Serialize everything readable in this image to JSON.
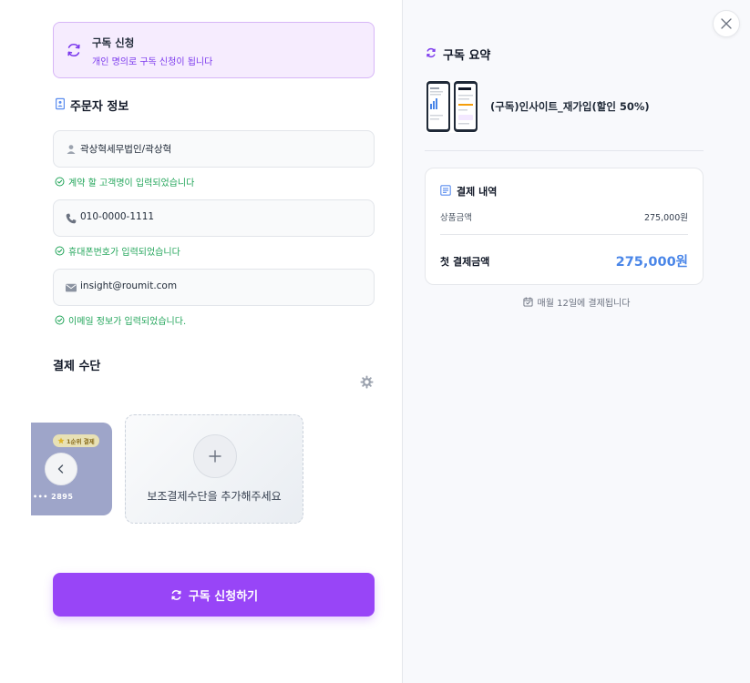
{
  "subscription_box": {
    "title": "구독 신청",
    "subtitle": "개인 명의로 구독 신청이 됩니다",
    "icon": "refresh-icon"
  },
  "orderer": {
    "title": "주문자 정보",
    "icon": "contact-card-icon",
    "fields": [
      {
        "icon": "person-icon",
        "value": "곽상혁세무법인/곽상혁",
        "validation": "계약 할 고객명이 입력되었습니다"
      },
      {
        "icon": "phone-icon",
        "value": "010-0000-1111",
        "validation": "휴대폰번호가 입력되었습니다"
      },
      {
        "icon": "mail-icon",
        "value": "insight@roumit.com",
        "validation": "이메일 정보가 입력되었습니다."
      }
    ]
  },
  "payment_method": {
    "title": "결제 수단",
    "main_card": {
      "badge": "1순위 결제",
      "masked_number": "••• 2895"
    },
    "add_card_label": "보조결제수단을 추가해주세요"
  },
  "submit": {
    "label": "구독 신청하기"
  },
  "summary": {
    "title": "구독 요약",
    "product_name": "(구독)인사이트_재가입(할인 50%)"
  },
  "payment_details": {
    "title": "결제 내역",
    "product_amount_label": "상품금액",
    "product_amount_value": "275,000원",
    "first_payment_label": "첫 결제금액",
    "first_payment_value": "275,000원"
  },
  "billing_note": "매월 12일에 결제됩니다",
  "colors": {
    "accent": "#9845f7",
    "valid": "#22a55a",
    "price": "#4a86e8",
    "subscription_box_bg": "#f6ecfe"
  }
}
